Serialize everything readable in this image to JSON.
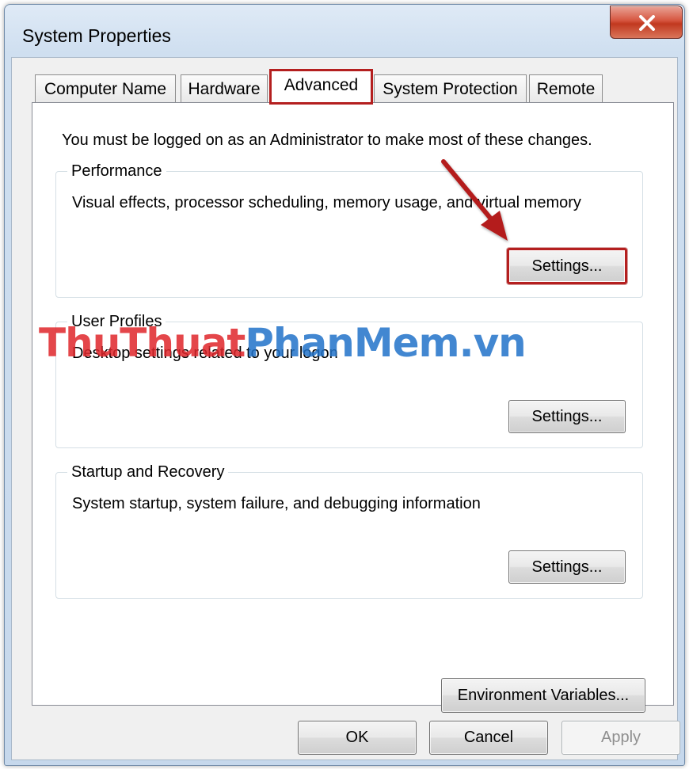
{
  "window": {
    "title": "System Properties",
    "close_symbol": "X"
  },
  "tabs": [
    {
      "label": "Computer Name",
      "active": false
    },
    {
      "label": "Hardware",
      "active": false
    },
    {
      "label": "Advanced",
      "active": true
    },
    {
      "label": "System Protection",
      "active": false
    },
    {
      "label": "Remote",
      "active": false
    }
  ],
  "content": {
    "admin_note": "You must be logged on as an Administrator to make most of these changes.",
    "performance": {
      "title": "Performance",
      "description": "Visual effects, processor scheduling, memory usage, and virtual memory",
      "settings_label": "Settings..."
    },
    "user_profiles": {
      "title": "User Profiles",
      "description": "Desktop settings related to your logon",
      "settings_label": "Settings..."
    },
    "startup_recovery": {
      "title": "Startup and Recovery",
      "description": "System startup, system failure, and debugging information",
      "settings_label": "Settings..."
    },
    "environment_variables_label": "Environment Variables..."
  },
  "buttons": {
    "ok": "OK",
    "cancel": "Cancel",
    "apply": "Apply"
  },
  "watermark": {
    "part1": "ThuThuat",
    "part2": "PhanMem",
    "part3": ".vn"
  },
  "colors": {
    "highlight_red": "#b41f1f",
    "watermark_red": "#e0262b",
    "watermark_blue": "#2273c9"
  }
}
